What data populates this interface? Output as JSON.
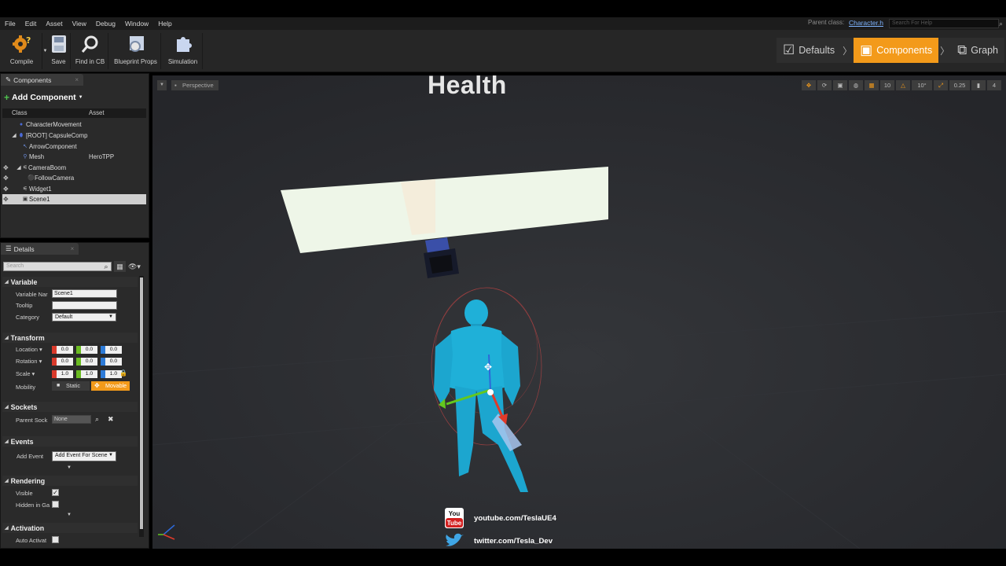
{
  "menu": [
    "File",
    "Edit",
    "Asset",
    "View",
    "Debug",
    "Window",
    "Help"
  ],
  "parent_class_label": "Parent class:",
  "parent_class_value": "Character.h",
  "help_search_placeholder": "Search For Help",
  "toolbar": {
    "compile": "Compile",
    "save": "Save",
    "find_in_cb": "Find in CB",
    "blueprint_props": "Blueprint Props",
    "simulation": "Simulation"
  },
  "modes": {
    "defaults": "Defaults",
    "components": "Components",
    "graph": "Graph"
  },
  "components_panel": {
    "tab": "Components",
    "add_component": "Add Component",
    "col_class": "Class",
    "col_asset": "Asset",
    "items": [
      {
        "name": "CharacterMovement",
        "asset": ""
      },
      {
        "name": "[ROOT] CapsuleComp",
        "asset": ""
      },
      {
        "name": "ArrowComponent",
        "asset": ""
      },
      {
        "name": "Mesh",
        "asset": "HeroTPP"
      },
      {
        "name": "CameraBoom",
        "asset": ""
      },
      {
        "name": "FollowCamera",
        "asset": ""
      },
      {
        "name": "Widget1",
        "asset": ""
      },
      {
        "name": "Scene1",
        "asset": ""
      }
    ]
  },
  "details_panel": {
    "tab": "Details",
    "search_placeholder": "Search",
    "variable": {
      "header": "Variable",
      "name_label": "Variable Nar",
      "name_value": "Scene1",
      "tooltip_label": "Tooltip",
      "tooltip_value": "",
      "category_label": "Category",
      "category_value": "Default"
    },
    "transform": {
      "header": "Transform",
      "location_label": "Location",
      "location": [
        "0.0",
        "0.0",
        "0.0"
      ],
      "rotation_label": "Rotation",
      "rotation": [
        "0.0",
        "0.0",
        "0.0"
      ],
      "scale_label": "Scale",
      "scale": [
        "1.0",
        "1.0",
        "1.0"
      ],
      "mobility_label": "Mobility",
      "static": "Static",
      "movable": "Movable"
    },
    "sockets": {
      "header": "Sockets",
      "parent_label": "Parent Sock",
      "parent_value": "None"
    },
    "events": {
      "header": "Events",
      "add_event_label": "Add Event",
      "add_event_value": "Add Event For Scene"
    },
    "rendering": {
      "header": "Rendering",
      "visible_label": "Visible",
      "visible_checked": true,
      "hidden_label": "Hidden in Ga",
      "hidden_checked": false
    },
    "activation": {
      "header": "Activation",
      "auto_label": "Auto Activat",
      "auto_checked": false
    }
  },
  "viewport": {
    "perspective": "Perspective",
    "health_text": "Health",
    "toolbar_values": {
      "grid": "10",
      "rot": "10°",
      "scale": "0.25",
      "cam": "4"
    },
    "youtube": "youtube.com/TeslaUE4",
    "twitter": "twitter.com/Tesla_Dev",
    "youtube_badge": "You Tube"
  },
  "colors": {
    "accent_orange": "#f39a1a",
    "character_cyan": "#1fb0d8",
    "widget_plane": "#eef6e8"
  }
}
